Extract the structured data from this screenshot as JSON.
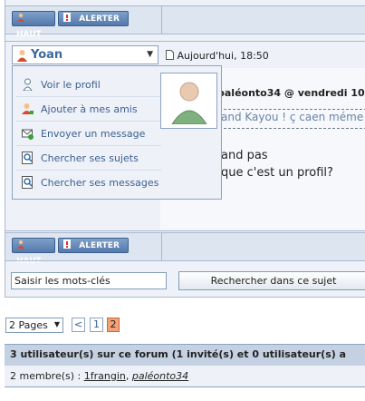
{
  "toolbar": {
    "haut_label": "HAUT",
    "alerter_label": "ALERTER"
  },
  "post": {
    "author": "Yoan",
    "date": "Aujourd'hui, 18:50",
    "quote_header": "paléonto34 @ vendredi 10 se",
    "quote_text": "and Kayou ! ç caen méme",
    "message_line1": "and pas",
    "message_line2": "que c'est un profil?"
  },
  "profile_menu": {
    "items": [
      {
        "label": "Voir le profil",
        "icon": "user-icon"
      },
      {
        "label": "Ajouter à mes amis",
        "icon": "add-friend-icon"
      },
      {
        "label": "Envoyer un message",
        "icon": "send-message-icon"
      },
      {
        "label": "Chercher ses sujets",
        "icon": "search-topics-icon"
      },
      {
        "label": "Chercher ses messages",
        "icon": "search-messages-icon"
      }
    ]
  },
  "search": {
    "value": "Saisir les mots-clés",
    "button": "Rechercher dans ce sujet"
  },
  "pagination": {
    "select_label": "2 Pages",
    "prev": "<",
    "pages": [
      "1",
      "2"
    ],
    "current": "2"
  },
  "online": {
    "header": "3 utilisateur(s) sur ce forum (1 invité(s) et 0 utilisateur(s) a",
    "members_prefix": "2 membre(s) :",
    "members": [
      "1frangin",
      "paléonto34"
    ]
  },
  "colors": {
    "accent": "#3b6aa0",
    "current_page": "#f3a276",
    "header_bg": "#c4d1e3"
  }
}
